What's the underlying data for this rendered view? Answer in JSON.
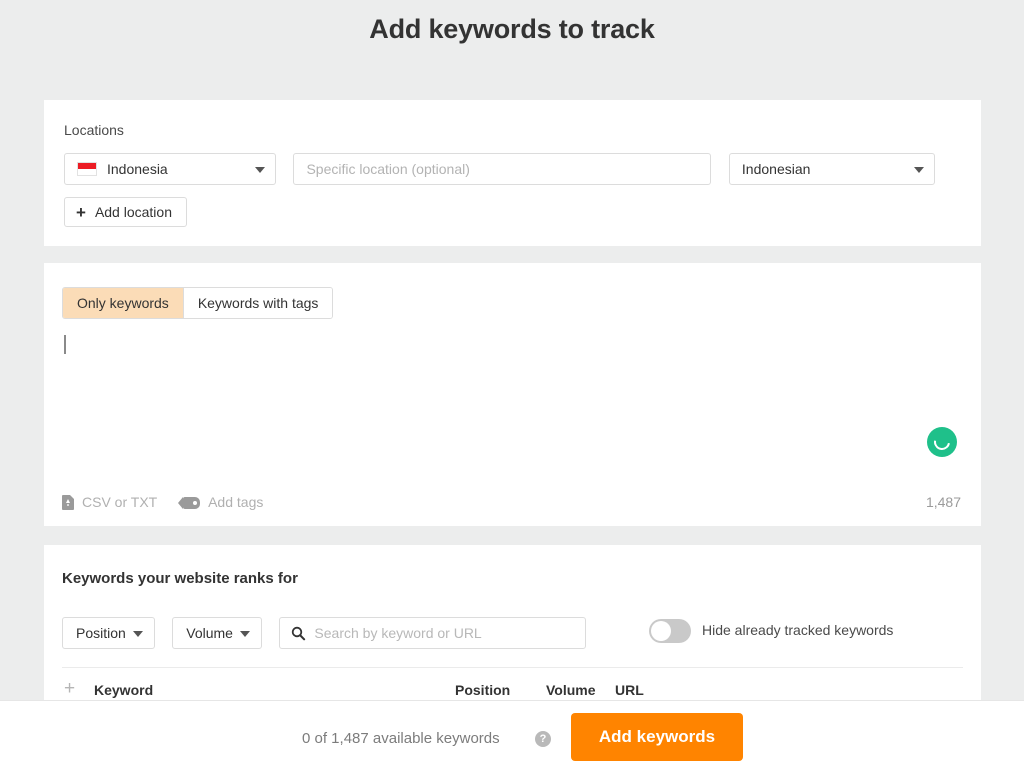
{
  "header": {
    "title": "Add keywords to track"
  },
  "locations": {
    "label": "Locations",
    "country": "Indonesia",
    "country_flag": "indonesia-flag-icon",
    "specific_location_placeholder": "Specific location (optional)",
    "language": "Indonesian",
    "add_location_label": "Add location",
    "plus_glyph": "+"
  },
  "keyword_input": {
    "tabs": [
      {
        "label": "Only keywords",
        "active": true
      },
      {
        "label": "Keywords with tags",
        "active": false
      }
    ],
    "textarea_value": "",
    "csv_label": "CSV or TXT",
    "tags_label": "Add tags",
    "count": "1,487",
    "spinner": "loading-spinner-icon"
  },
  "ranks": {
    "title": "Keywords your website ranks for",
    "filters": [
      {
        "label": "Position"
      },
      {
        "label": "Volume"
      }
    ],
    "search_placeholder": "Search by keyword or URL",
    "search_value": "",
    "toggle_label": "Hide already tracked keywords",
    "toggle_on": false,
    "columns": {
      "keyword": "Keyword",
      "position": "Position",
      "volume": "Volume",
      "url": "URL"
    },
    "add_column_glyph": "+"
  },
  "footer": {
    "available_text": "0 of 1,487 available keywords",
    "help_glyph": "?",
    "add_keywords_label": "Add keywords"
  },
  "colors": {
    "page_background": "#eceded",
    "card_background": "#ffffff",
    "accent_orange": "#ff8400",
    "tab_active": "#fbdcb7",
    "spinner_green": "#1fc08a",
    "flag_red": "#ec1c24"
  }
}
